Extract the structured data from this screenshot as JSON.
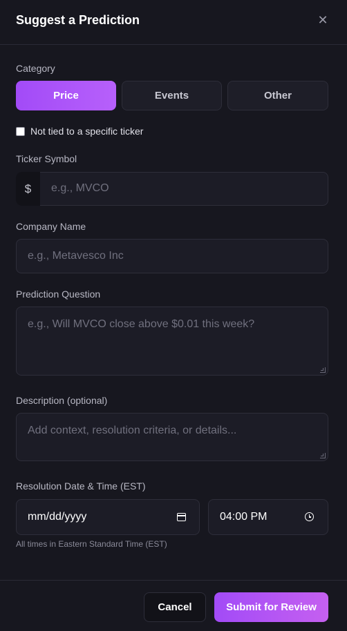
{
  "header": {
    "title": "Suggest a Prediction",
    "close_glyph": "✕"
  },
  "category": {
    "label": "Category",
    "options": [
      {
        "label": "Price",
        "active": true
      },
      {
        "label": "Events",
        "active": false
      },
      {
        "label": "Other",
        "active": false
      }
    ]
  },
  "not_tied": {
    "label": "Not tied to a specific ticker",
    "checked": false
  },
  "ticker": {
    "label": "Ticker Symbol",
    "prefix": "$",
    "placeholder": "e.g., MVCO"
  },
  "company": {
    "label": "Company Name",
    "placeholder": "e.g., Metavesco Inc"
  },
  "question": {
    "label": "Prediction Question",
    "placeholder": "e.g., Will MVCO close above $0.01 this week?"
  },
  "description": {
    "label": "Description (optional)",
    "placeholder": "Add context, resolution criteria, or details..."
  },
  "resolution": {
    "label": "Resolution Date & Time (EST)",
    "date_value": "mm/dd/yyyy",
    "time_value": "04:00 PM",
    "hint": "All times in Eastern Standard Time (EST)"
  },
  "footer": {
    "cancel_label": "Cancel",
    "submit_label": "Submit for Review"
  },
  "colors": {
    "accent": "#a24bf7",
    "background": "#17171f",
    "field": "#1c1c26"
  },
  "icons": {
    "close": "close-icon",
    "calendar": "calendar-icon",
    "clock": "clock-icon"
  }
}
